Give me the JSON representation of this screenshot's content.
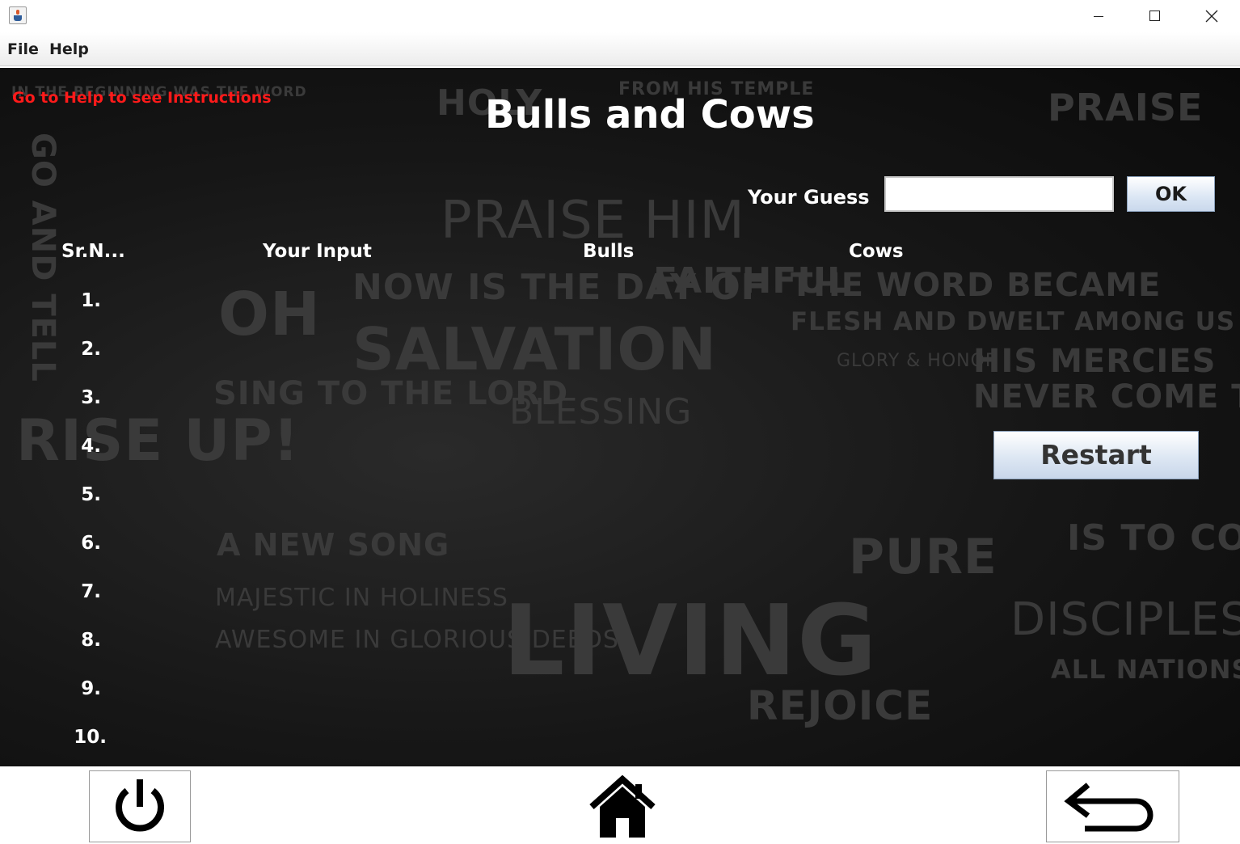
{
  "menu": {
    "file": "File",
    "help": "Help"
  },
  "game": {
    "instructions": "Go to Help to see Instructions",
    "title": "Bulls and Cows",
    "guess_label": "Your Guess",
    "guess_value": "",
    "ok_label": "OK",
    "restart_label": "Restart"
  },
  "table": {
    "headers": {
      "sr": "Sr.N...",
      "input": "Your Input",
      "bulls": "Bulls",
      "cows": "Cows"
    },
    "row_numbers": [
      "1.",
      "2.",
      "3.",
      "4.",
      "5.",
      "6.",
      "7.",
      "8.",
      "9.",
      "10."
    ]
  },
  "background_words": [
    "IN THE BEGINNING WAS THE WORD",
    "GO AND TELL",
    "HOLY",
    "FROM HIS TEMPLE",
    "PRAISE HIM",
    "PRAISE",
    "THE WORD BECAME",
    "FLESH AND DWELT AMONG US",
    "NOW IS THE DAY OF",
    "SALVATION",
    "FAITHFUL",
    "OH",
    "SING TO THE LORD",
    "RISE UP!",
    "HIS MERCIES",
    "NEVER COME TO AN END",
    "BLESSING",
    "A NEW SONG",
    "LIVING",
    "MAJESTIC IN HOLINESS",
    "AWESOME IN GLORIOUS DEEDS",
    "REJOICE",
    "PURE",
    "DISCIPLES",
    "ALL NATIONS",
    "IS TO COME",
    "GLORY & HONOR"
  ],
  "icons": {
    "power": "power-icon",
    "home": "home-icon",
    "back": "back-arrow-icon"
  }
}
